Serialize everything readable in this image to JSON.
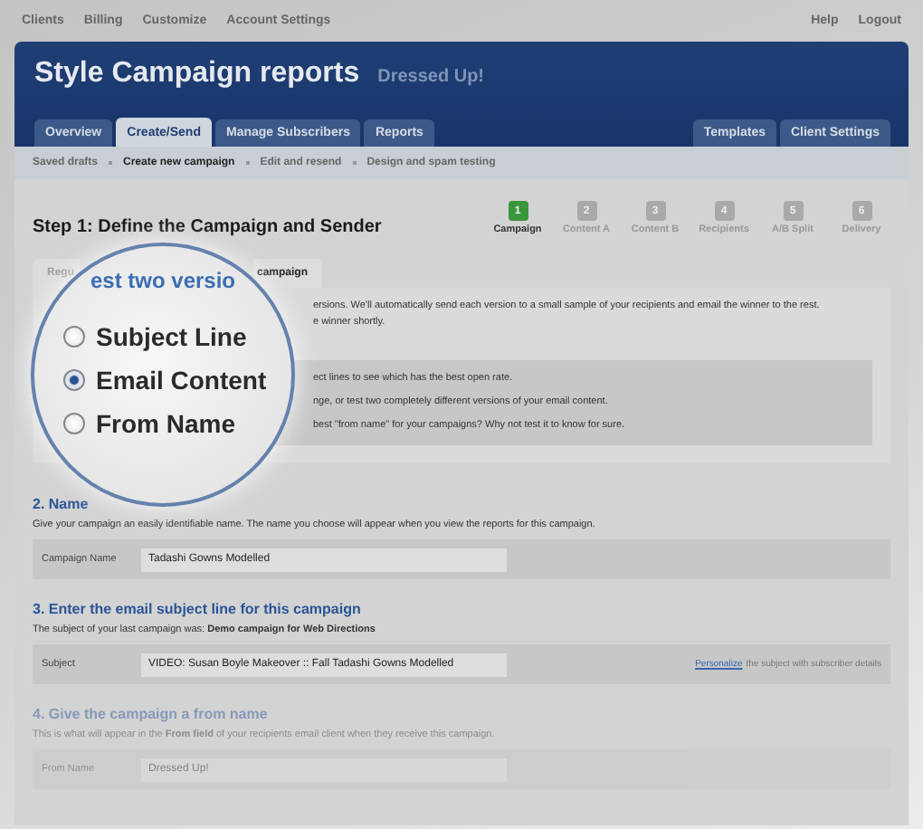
{
  "top_nav": {
    "left": [
      "Clients",
      "Billing",
      "Customize",
      "Account Settings"
    ],
    "right": [
      "Help",
      "Logout"
    ]
  },
  "header": {
    "title": "Style Campaign reports",
    "subtitle": "Dressed Up!"
  },
  "main_tabs": [
    {
      "label": "Overview",
      "selected": false
    },
    {
      "label": "Create/Send",
      "selected": true
    },
    {
      "label": "Manage Subscribers",
      "selected": false
    },
    {
      "label": "Reports",
      "selected": false
    }
  ],
  "right_tabs": [
    {
      "label": "Templates",
      "selected": false
    },
    {
      "label": "Client Settings",
      "selected": false
    }
  ],
  "sub_nav": [
    {
      "label": "Saved drafts",
      "selected": false
    },
    {
      "label": "Create new campaign",
      "selected": true
    },
    {
      "label": "Edit and resend",
      "selected": false
    },
    {
      "label": "Design and spam testing",
      "selected": false
    }
  ],
  "step_title": "Step 1: Define the Campaign and Sender",
  "steps": [
    {
      "number": "1",
      "label": "Campaign",
      "selected": true
    },
    {
      "number": "2",
      "label": "Content A",
      "selected": false
    },
    {
      "number": "3",
      "label": "Content B",
      "selected": false
    },
    {
      "number": "4",
      "label": "Recipients",
      "selected": false
    },
    {
      "number": "5",
      "label": "A/B Split",
      "selected": false
    },
    {
      "number": "6",
      "label": "Delivery",
      "selected": false
    }
  ],
  "campaign_tab": {
    "label_start": "Regu",
    "label_end": "campaign"
  },
  "intro_lines": [
    "ersions. We'll automatically send each version to a small sample of your recipients and email the winner to the rest.",
    "e winner shortly."
  ],
  "option_descriptions": [
    "ect lines to see which has the best open rate.",
    "nge, or test two completely different versions of your email content.",
    "best \"from name\" for your campaigns? Why not test it to know for sure."
  ],
  "magnifier": {
    "heading": "est two versio",
    "options": [
      {
        "label": "Subject Line",
        "selected": false
      },
      {
        "label": "Email Content",
        "selected": true
      },
      {
        "label": "From Name",
        "selected": false
      }
    ]
  },
  "sections": [
    {
      "heading": "2. Name",
      "text": "Give your campaign an easily identifiable name. The name you choose will appear when you view the reports for this campaign.",
      "field": {
        "label": "Campaign Name",
        "value": "Tadashi Gowns Modelled"
      },
      "faded": false
    },
    {
      "heading": "3. Enter the email subject line for this campaign",
      "text": "The subject of your last campaign was: **Demo campaign for Web Directions**",
      "field": {
        "label": "Subject",
        "value": "VIDEO: Susan Boyle Makeover :: Fall Tadashi Gowns Modelled",
        "link": "Personalize",
        "hint": "the subject with subscriber details"
      },
      "faded": false
    },
    {
      "heading": "4. Give the campaign a from name",
      "text": "This is what will appear in the **From field** of your recipients email client when they receive this campaign.",
      "field": {
        "label": "From Name",
        "value": "Dressed Up!"
      },
      "faded": true
    }
  ]
}
